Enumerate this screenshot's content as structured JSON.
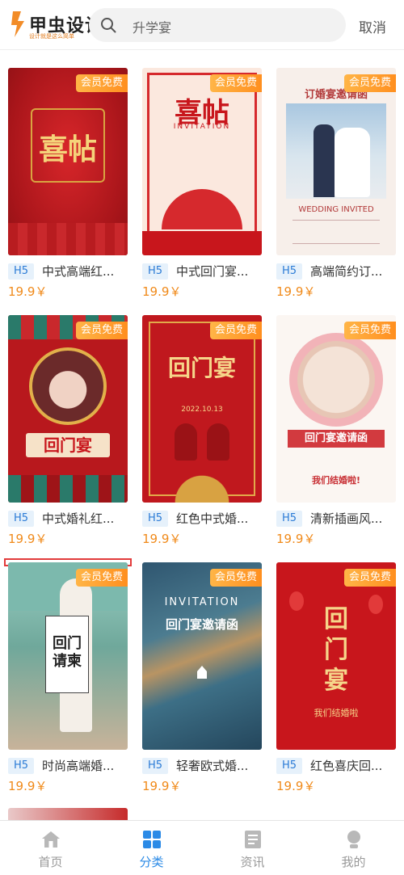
{
  "app": {
    "logo_text": "甲虫设计",
    "logo_sub": "设计就是这么简单",
    "search_query": "升学宴",
    "cancel_label": "取消"
  },
  "cards": [
    {
      "badge": "会员免费",
      "type": "H5",
      "title": "中式高端红...",
      "price": "19.9￥",
      "main_text": "喜帖"
    },
    {
      "badge": "会员免费",
      "type": "H5",
      "title": "中式回门宴...",
      "price": "19.9￥",
      "main_text": "喜帖",
      "sub_text": "INVITATION"
    },
    {
      "badge": "会员免费",
      "type": "H5",
      "title": "高端简约订...",
      "price": "19.9￥",
      "main_text": "订婚宴邀请函",
      "sub_text": "WEDDING INVITED"
    },
    {
      "badge": "会员免费",
      "type": "H5",
      "title": "中式婚礼红...",
      "price": "19.9￥",
      "main_text": "回门宴"
    },
    {
      "badge": "会员免费",
      "type": "H5",
      "title": "红色中式婚...",
      "price": "19.9￥",
      "main_text": "回门宴",
      "sub_text": "2022.10.13"
    },
    {
      "badge": "会员免费",
      "type": "H5",
      "title": "清新插画风...",
      "price": "19.9￥",
      "main_text": "回门宴邀请函",
      "sub_text": "我们结婚啦!"
    },
    {
      "badge": "会员免费",
      "type": "H5",
      "title": "时尚高端婚...",
      "price": "19.9￥",
      "main_text": "回门请柬"
    },
    {
      "badge": "会员免费",
      "type": "H5",
      "title": "轻奢欧式婚...",
      "price": "19.9￥",
      "main_text": "回门宴邀请函",
      "sub_text": "INVITATION"
    },
    {
      "badge": "会员免费",
      "type": "H5",
      "title": "红色喜庆回...",
      "price": "19.9￥",
      "main_text": "回门宴",
      "sub_text": "我们结婚啦"
    }
  ],
  "nav": [
    {
      "label": "首页",
      "icon": "home-icon"
    },
    {
      "label": "分类",
      "icon": "grid-icon"
    },
    {
      "label": "资讯",
      "icon": "news-icon"
    },
    {
      "label": "我的",
      "icon": "user-icon"
    }
  ],
  "colors": {
    "accent": "#2b8ae6",
    "price": "#f08a1a",
    "badge": "#ff9f2e",
    "selection": "#e23b3b"
  }
}
